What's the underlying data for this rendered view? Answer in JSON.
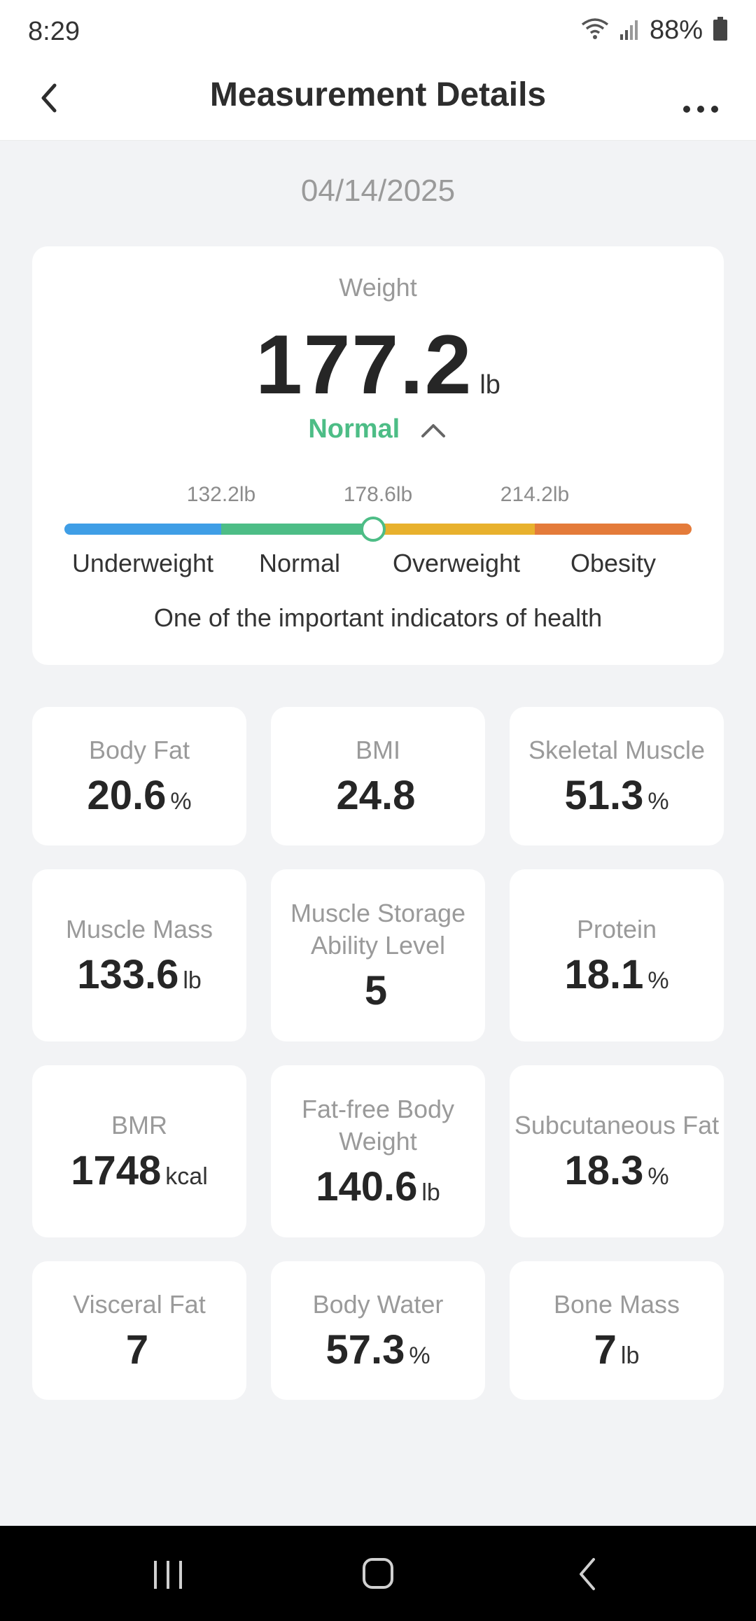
{
  "status_bar": {
    "time": "8:29",
    "battery": "88%"
  },
  "header": {
    "title": "Measurement Details",
    "back_icon": "back-arrow-icon",
    "more_icon": "more-dots-icon"
  },
  "date": "04/14/2025",
  "weight": {
    "label": "Weight",
    "value": "177.2",
    "unit": "lb",
    "status": "Normal",
    "status_color": "#4dbd86",
    "thresholds": [
      "132.2lb",
      "178.6lb",
      "214.2lb"
    ],
    "categories": [
      "Underweight",
      "Normal",
      "Overweight",
      "Obesity"
    ],
    "category_colors": [
      "#3f9ee6",
      "#4dbd86",
      "#e8b12d",
      "#e47b3a"
    ],
    "marker_value": 177.2,
    "description": "One of the important indicators of health"
  },
  "metrics": [
    {
      "label": "Body Fat",
      "value": "20.6",
      "unit": "%"
    },
    {
      "label": "BMI",
      "value": "24.8",
      "unit": ""
    },
    {
      "label": "Skeletal Muscle",
      "value": "51.3",
      "unit": "%"
    },
    {
      "label": "Muscle Mass",
      "value": "133.6",
      "unit": "lb"
    },
    {
      "label": "Muscle Storage Ability Level",
      "value": "5",
      "unit": ""
    },
    {
      "label": "Protein",
      "value": "18.1",
      "unit": "%"
    },
    {
      "label": "BMR",
      "value": "1748",
      "unit": "kcal"
    },
    {
      "label": "Fat-free Body Weight",
      "value": "140.6",
      "unit": "lb"
    },
    {
      "label": "Subcutaneous Fat",
      "value": "18.3",
      "unit": "%"
    },
    {
      "label": "Visceral Fat",
      "value": "7",
      "unit": ""
    },
    {
      "label": "Body Water",
      "value": "57.3",
      "unit": "%"
    },
    {
      "label": "Bone Mass",
      "value": "7",
      "unit": "lb"
    }
  ]
}
